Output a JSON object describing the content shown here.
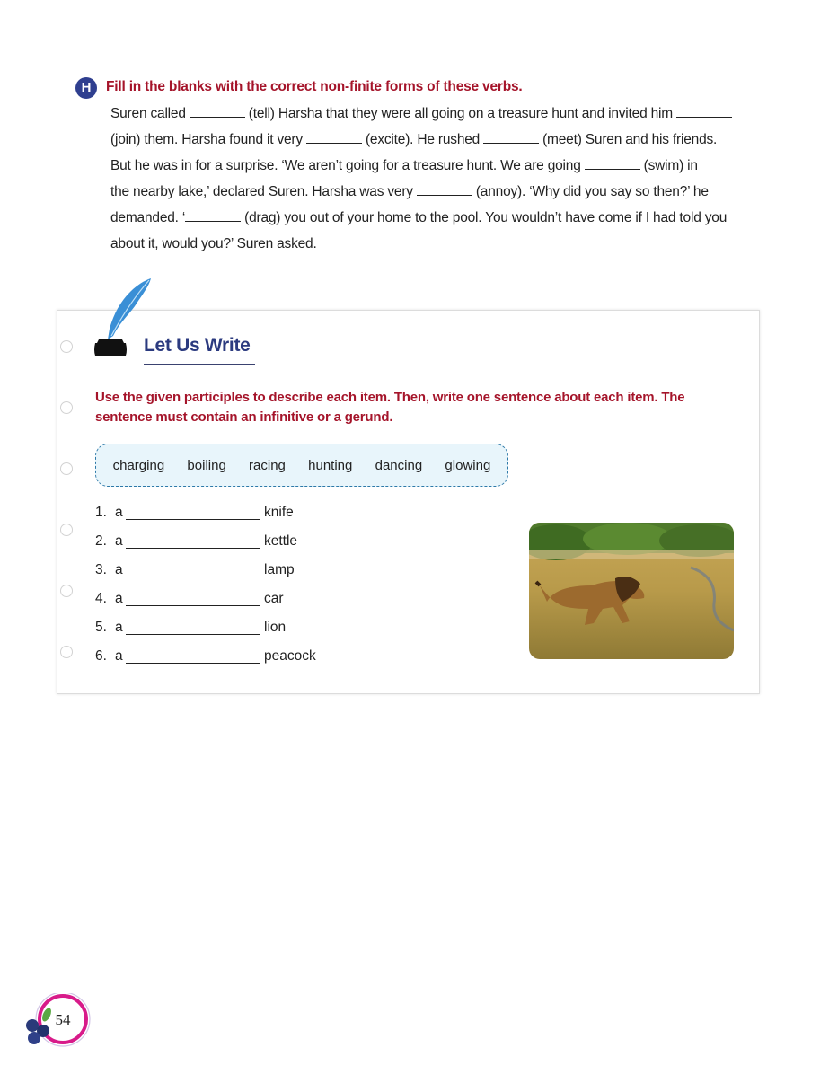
{
  "section_h": {
    "badge": "H",
    "title": "Fill in the blanks with the correct non-finite forms of these verbs.",
    "lines": [
      {
        "parts": [
          "Suren called",
          "(tell) Harsha that they were all going on a treasure hunt and invited him",
          ""
        ]
      },
      {
        "parts": [
          "(join) them. Harsha found it very",
          "(excite). He rushed",
          "(meet) Suren and his friends."
        ]
      },
      {
        "parts": [
          "But he was in for a surprise. ‘We aren’t going for a treasure hunt. We are going",
          "(swim) in"
        ]
      },
      {
        "parts": [
          "the nearby lake,’ declared Suren. Harsha was very",
          "(annoy). ‘Why did you say so then?’ he"
        ]
      },
      {
        "parts": [
          "demanded. ‘",
          "(drag) you out of your home to the pool. You wouldn’t have come if I had told you"
        ]
      },
      {
        "parts": [
          "about it, would you?’ Suren asked."
        ]
      }
    ]
  },
  "let_us_write": {
    "title": "Let Us Write",
    "icon": "quill-inkpot-icon",
    "instruction": "Use the given participles to describe each item. Then, write one sentence about each item. The sentence must contain an infinitive or a gerund.",
    "words": [
      "charging",
      "boiling",
      "racing",
      "hunting",
      "dancing",
      "glowing"
    ],
    "items": [
      {
        "num": "1.",
        "article": "a",
        "noun": "knife"
      },
      {
        "num": "2.",
        "article": "a",
        "noun": "kettle"
      },
      {
        "num": "3.",
        "article": "a",
        "noun": "lamp"
      },
      {
        "num": "4.",
        "article": "a",
        "noun": "car"
      },
      {
        "num": "5.",
        "article": "a",
        "noun": "lion"
      },
      {
        "num": "6.",
        "article": "a",
        "noun": "peacock"
      }
    ],
    "image": "running-lion-photo"
  },
  "page_number": "54",
  "colors": {
    "heading_red": "#a5142a",
    "badge_blue": "#2f3f8f",
    "title_blue": "#2b3a7f",
    "wordbox_bg": "#e8f5fb",
    "wordbox_border": "#2d79a8",
    "pagenum_ring": "#d81b8a"
  }
}
